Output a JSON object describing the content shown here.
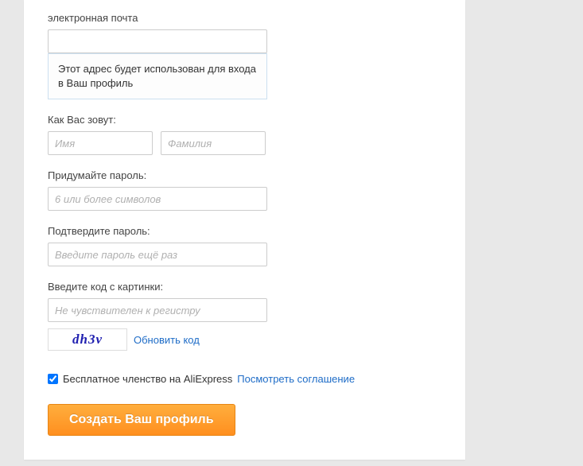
{
  "email": {
    "label": "электронная почта",
    "value": "",
    "hint": "Этот адрес будет использован для входа в Ваш профиль"
  },
  "name": {
    "label": "Как Вас зовут:",
    "first_placeholder": "Имя",
    "last_placeholder": "Фамилия"
  },
  "password": {
    "label": "Придумайте пароль:",
    "placeholder": "6 или более символов"
  },
  "password_confirm": {
    "label": "Подтвердите пароль:",
    "placeholder": "Введите пароль ещё раз"
  },
  "captcha": {
    "label": "Введите код с картинки:",
    "placeholder": "Не чувствителен к регистру",
    "code": "dh3v",
    "refresh": "Обновить код"
  },
  "agreement": {
    "text": "Бесплатное членство на AliExpress",
    "link": "Посмотреть соглашение",
    "checked": true
  },
  "submit": "Создать Ваш профиль"
}
